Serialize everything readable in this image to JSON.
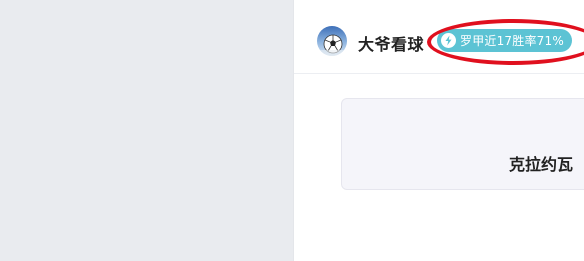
{
  "author": {
    "name": "大爷看球",
    "avatar_icon": "soccer-ball-avatar-icon"
  },
  "badge": {
    "icon": "lightning-icon",
    "text": "罗甲近17胜率71%",
    "color": "#5cc3d4"
  },
  "card": {
    "title": "克拉约瓦"
  },
  "colors": {
    "left_panel": "#e9ebef",
    "annotation": "#e0101e",
    "card_bg": "#f5f5fa"
  }
}
